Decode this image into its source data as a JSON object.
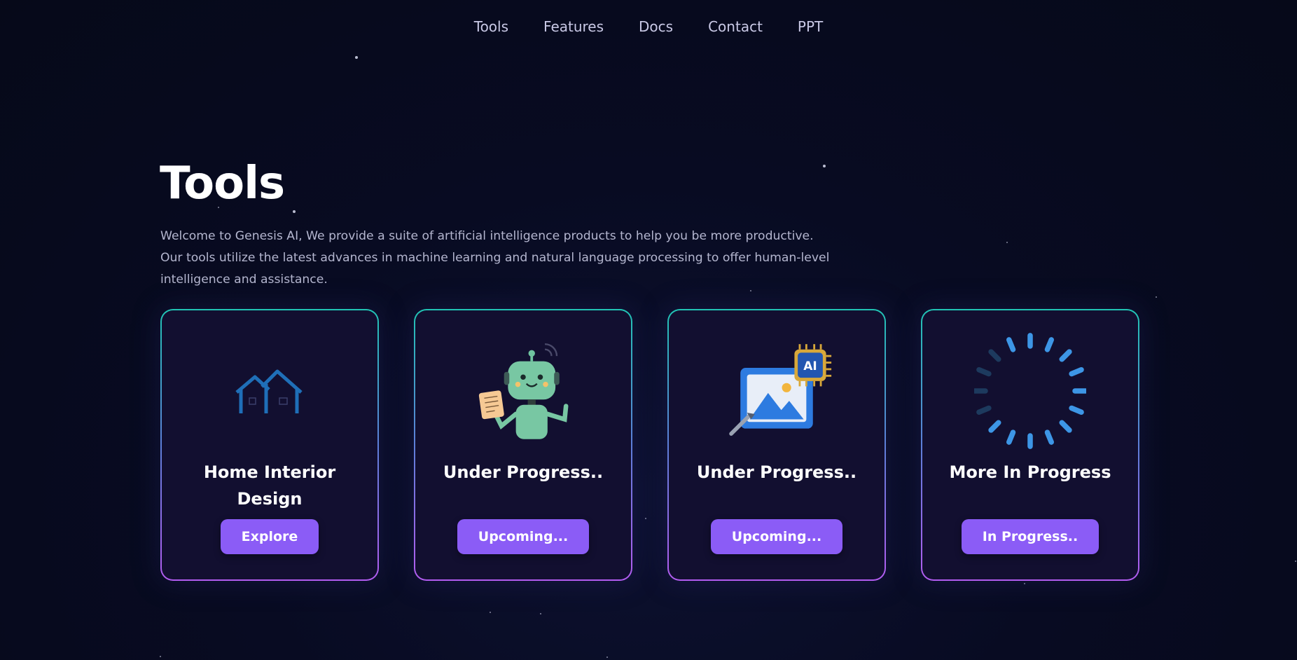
{
  "nav": {
    "items": [
      "Tools",
      "Features",
      "Docs",
      "Contact",
      "PPT"
    ]
  },
  "hero": {
    "title": "Tools",
    "description": "Welcome to Genesis AI, We provide a suite of artificial intelligence products to help you be more productive. Our tools utilize the latest advances in machine learning and natural language processing to offer human-level intelligence and assistance."
  },
  "cards": [
    {
      "title": "Home Interior Design",
      "button": "Explore",
      "icon": "house-icon"
    },
    {
      "title": "Under Progress..",
      "button": "Upcoming...",
      "icon": "robot-icon"
    },
    {
      "title": "Under Progress..",
      "button": "Upcoming...",
      "icon": "ai-image-icon"
    },
    {
      "title": "More In Progress",
      "button": "In Progress..",
      "icon": "loading-spinner-icon"
    }
  ],
  "colors": {
    "background": "#070a1d",
    "card_background": "#120f30",
    "border_top": "#21c4b4",
    "border_bottom": "#b35cf0",
    "button": "#8b5cf6",
    "nav_text": "#c9c9e6"
  }
}
